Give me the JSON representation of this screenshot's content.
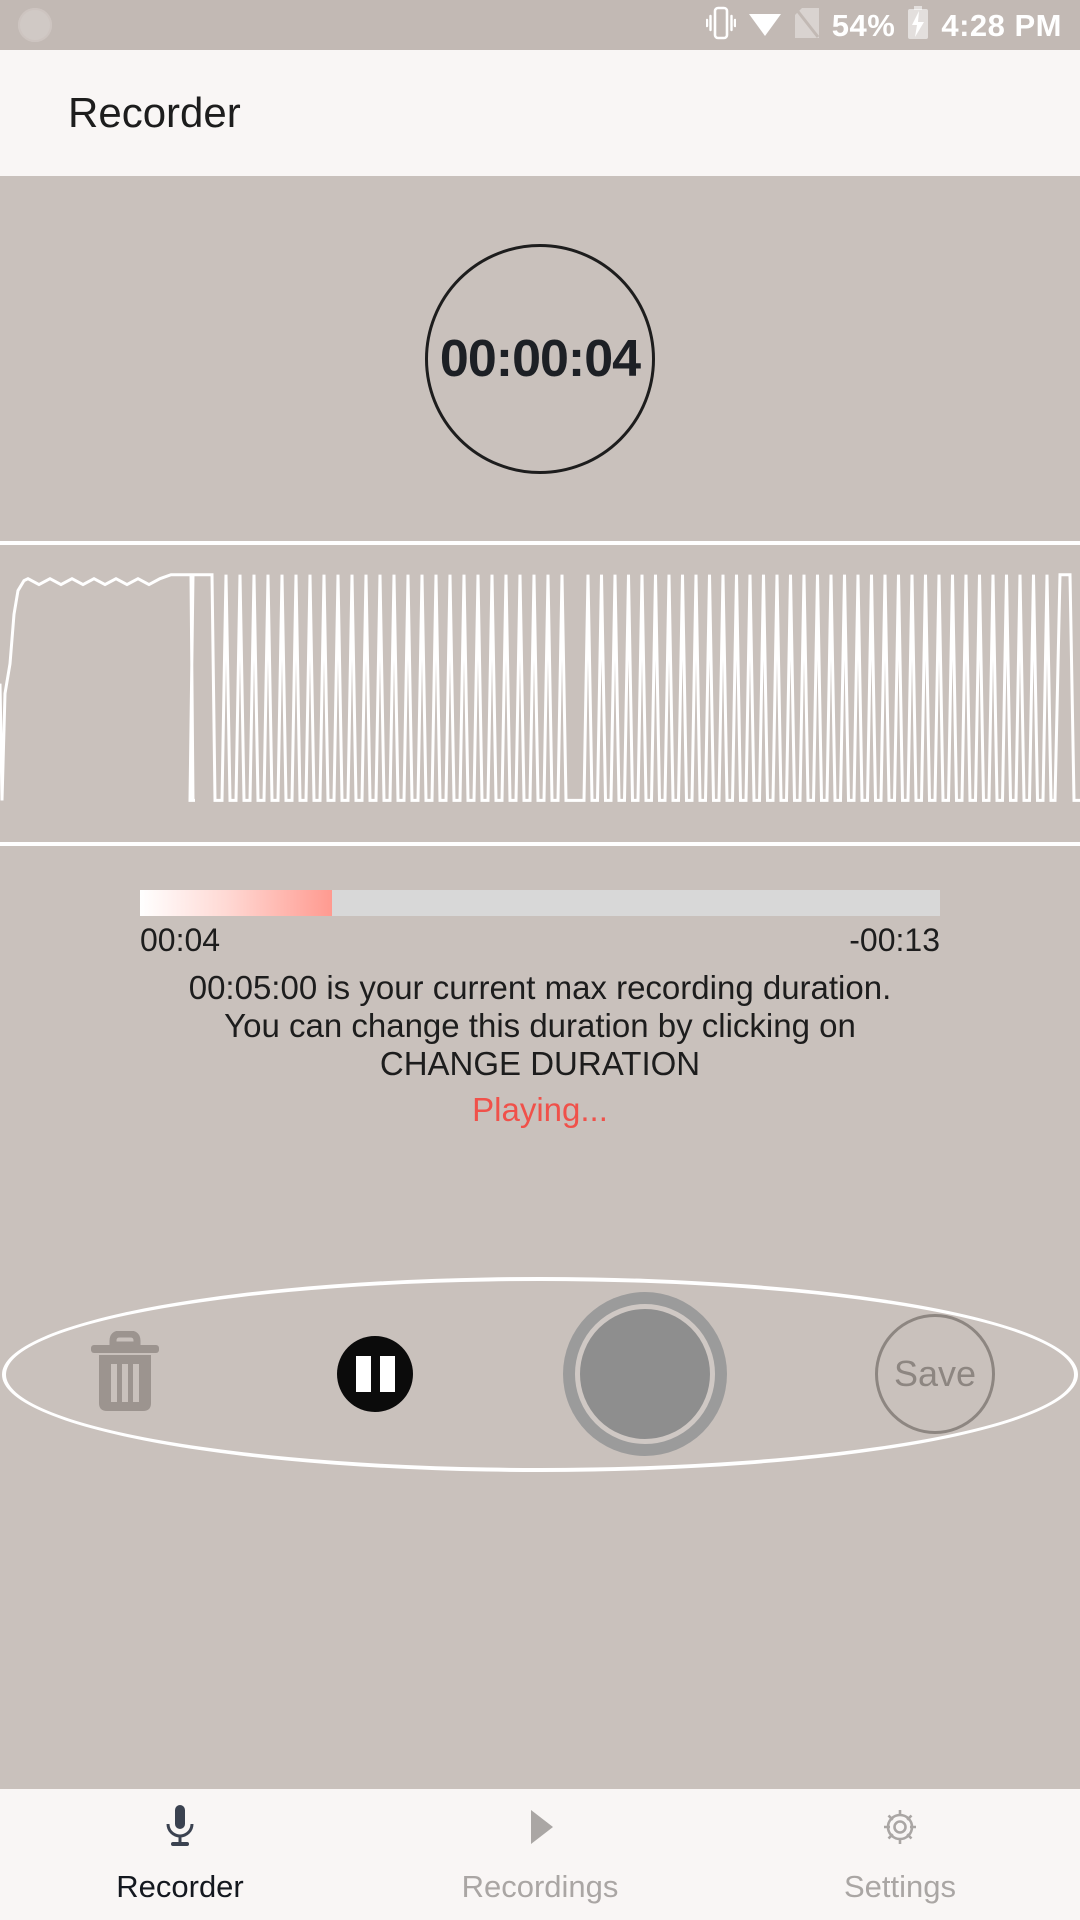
{
  "statusbar": {
    "notification_icon": "circle-notification-icon",
    "vibrate_icon": "vibrate-icon",
    "wifi_icon": "wifi-icon",
    "no_sim_icon": "no-sim-icon",
    "battery_percent": "54%",
    "battery_icon": "battery-charging-icon",
    "time": "4:28 PM"
  },
  "appbar": {
    "title": "Recorder"
  },
  "timer": {
    "elapsed": "00:00:04"
  },
  "waveform": {
    "label": "audio-waveform"
  },
  "progress": {
    "percent": 24,
    "elapsed": "00:04",
    "remaining": "-00:13"
  },
  "info": {
    "line1": "00:05:00 is your current max recording duration.",
    "line2": "You can change this duration by clicking on",
    "line3": "CHANGE DURATION",
    "status": "Playing...",
    "status_color": "#f0514a"
  },
  "controls": {
    "delete_icon": "trash-icon",
    "pause_icon": "pause-icon",
    "record_icon": "record-button-icon",
    "save_label": "Save"
  },
  "bottomnav": {
    "items": [
      {
        "label": "Recorder",
        "icon": "microphone-icon",
        "active": true
      },
      {
        "label": "Recordings",
        "icon": "play-triangle-icon",
        "active": false
      },
      {
        "label": "Settings",
        "icon": "gear-icon",
        "active": false
      }
    ]
  },
  "colors": {
    "background": "#c9c1bc",
    "appbar": "#f9f6f5",
    "accent_red": "#f0514a",
    "progress_track": "#d8d8d8"
  }
}
